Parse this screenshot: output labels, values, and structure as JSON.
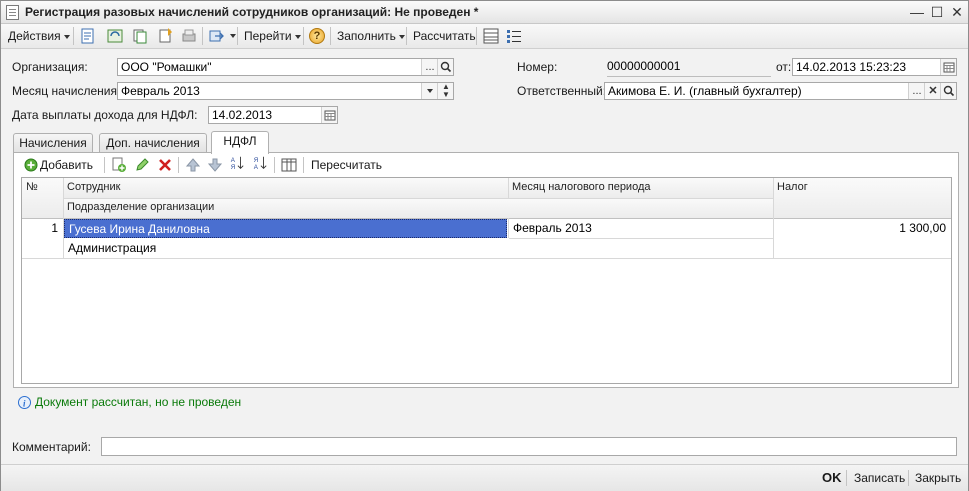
{
  "window": {
    "title": "Регистрация разовых начислений сотрудников организаций: Не проведен *",
    "minimize": "—",
    "maximize": "☐",
    "close": "✕"
  },
  "toolbar": {
    "actions_label": "Действия",
    "goto_label": "Перейти",
    "fill_label": "Заполнить",
    "calculate_label": "Рассчитать",
    "help_label": "?"
  },
  "form": {
    "organization_label": "Организация:",
    "organization_value": "ООО \"Ромашки\"",
    "month_label": "Месяц начисления:",
    "month_value": "Февраль 2013",
    "payout_date_label": "Дата выплаты дохода для НДФЛ:",
    "payout_date_value": "14.02.2013",
    "number_label": "Номер:",
    "number_value": "00000000001",
    "from_label": "от:",
    "from_value": "14.02.2013 15:23:23",
    "responsible_label": "Ответственный:",
    "responsible_value": "Акимова Е. И. (главный бухгалтер)",
    "ellipsis": "...",
    "clear": "✕"
  },
  "tabs": [
    {
      "label": "Начисления"
    },
    {
      "label": "Доп. начисления"
    },
    {
      "label": "НДФЛ"
    }
  ],
  "panel_toolbar": {
    "add_label": "Добавить",
    "recalc_label": "Пересчитать"
  },
  "grid": {
    "headers": {
      "num": "№",
      "employee": "Сотрудник",
      "department": "Подразделение организации",
      "tax_month": "Месяц налогового периода",
      "tax": "Налог"
    },
    "rows": [
      {
        "num": "1",
        "employee": "Гусева Ирина Даниловна",
        "department": "Администрация",
        "tax_month": "Февраль 2013",
        "tax": "1 300,00"
      }
    ]
  },
  "status_message": "Документ рассчитан, но не проведен",
  "comment_label": "Комментарий:",
  "comment_value": "",
  "footer": {
    "ok_label": "OK",
    "save_label": "Записать",
    "close_label": "Закрыть"
  },
  "colors": {
    "selected_row": "#4a6fd0",
    "status_text": "#0a7a0a",
    "info_icon": "#2c6fd0",
    "delete_icon": "#d02020",
    "edit_icon": "#3a9a2a"
  }
}
